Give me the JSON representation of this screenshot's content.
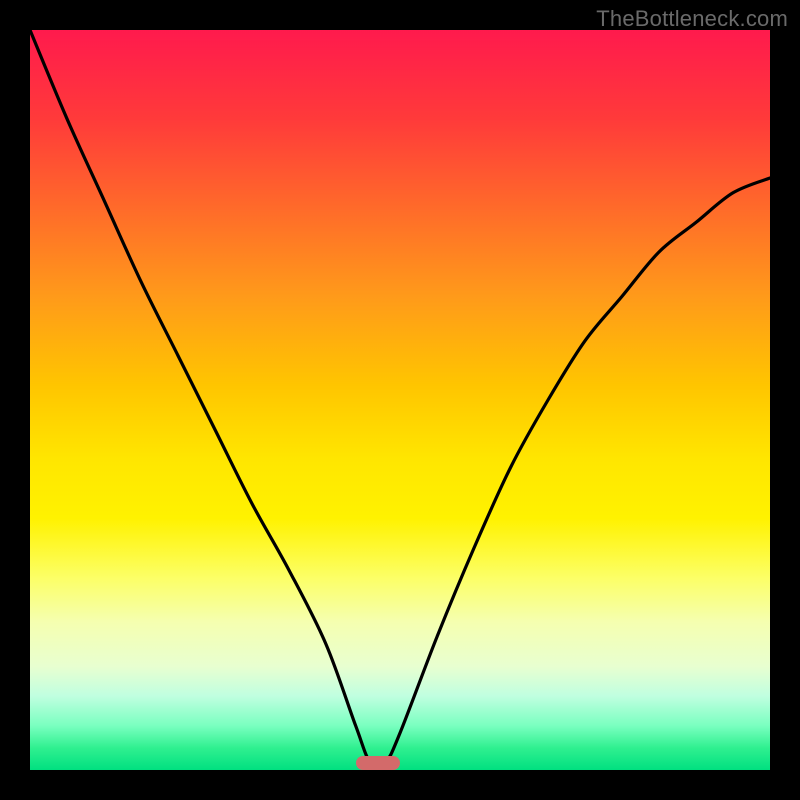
{
  "watermark": "TheBottleneck.com",
  "colors": {
    "frame": "#000000",
    "curve": "#000000",
    "marker": "#d36a6a",
    "gradient_top": "#ff1a4d",
    "gradient_bottom": "#00e080"
  },
  "chart_data": {
    "type": "line",
    "title": "",
    "xlabel": "",
    "ylabel": "",
    "xlim": [
      0,
      100
    ],
    "ylim": [
      0,
      100
    ],
    "grid": false,
    "legend": false,
    "series": [
      {
        "name": "bottleneck-curve",
        "x": [
          0,
          5,
          10,
          15,
          20,
          25,
          30,
          35,
          40,
          44,
          46,
          48,
          50,
          55,
          60,
          65,
          70,
          75,
          80,
          85,
          90,
          95,
          100
        ],
        "y": [
          100,
          88,
          77,
          66,
          56,
          46,
          36,
          27,
          17,
          6,
          1,
          1,
          5,
          18,
          30,
          41,
          50,
          58,
          64,
          70,
          74,
          78,
          80
        ]
      }
    ],
    "marker": {
      "x_start": 44,
      "x_end": 50,
      "y": 0
    },
    "background_gradient": {
      "direction": "vertical",
      "stops": [
        {
          "pos": 0.0,
          "color": "#ff1a4d"
        },
        {
          "pos": 0.48,
          "color": "#ffc500"
        },
        {
          "pos": 0.66,
          "color": "#fff200"
        },
        {
          "pos": 0.86,
          "color": "#e8ffd0"
        },
        {
          "pos": 1.0,
          "color": "#00e080"
        }
      ]
    }
  }
}
